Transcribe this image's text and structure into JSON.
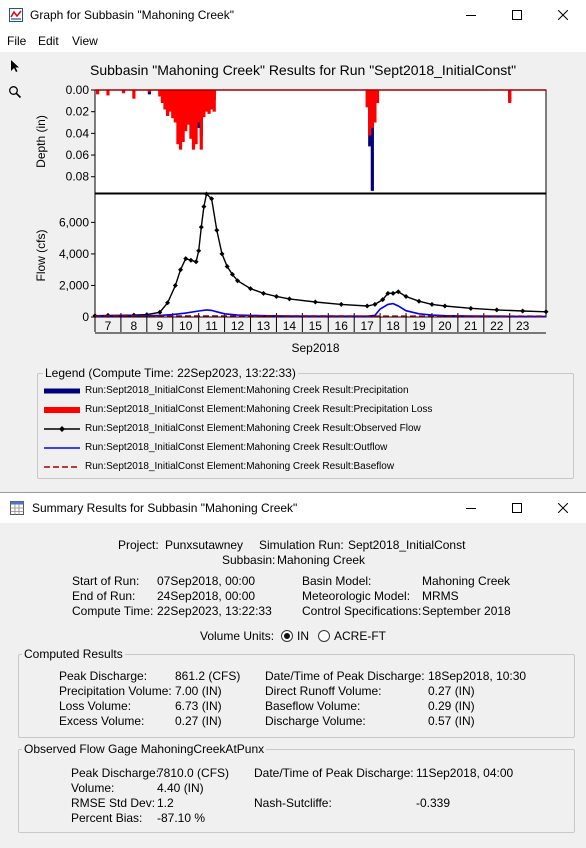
{
  "graph_window": {
    "title": "Graph for Subbasin \"Mahoning Creek\"",
    "menu": [
      "File",
      "Edit",
      "View"
    ],
    "tools": [
      "arrow-icon",
      "zoom-icon"
    ],
    "chart_title": "Subbasin \"Mahoning Creek\" Results for Run \"Sept2018_InitialConst\"",
    "legend_title": "Legend (Compute Time: 22Sep2023, 13:22:33)",
    "legend": [
      {
        "label": "Run:Sept2018_InitialConst Element:Mahoning Creek Result:Precipitation",
        "color": "#00007a",
        "style": "thick"
      },
      {
        "label": "Run:Sept2018_InitialConst Element:Mahoning Creek Result:Precipitation Loss",
        "color": "#ff0000",
        "style": "thick"
      },
      {
        "label": "Run:Sept2018_InitialConst Element:Mahoning Creek Result:Observed Flow",
        "color": "#000000",
        "style": "marker"
      },
      {
        "label": "Run:Sept2018_InitialConst Element:Mahoning Creek Result:Outflow",
        "color": "#0000ff",
        "style": "line"
      },
      {
        "label": "Run:Sept2018_InitialConst Element:Mahoning Creek Result:Baseflow",
        "color": "#a00000",
        "style": "dashed"
      }
    ]
  },
  "chart_data": [
    {
      "type": "bar",
      "ylabel": "Depth (in)",
      "ylim": [
        0.0,
        0.095
      ],
      "inverted": true,
      "yticks": [
        "0.00",
        "0.02",
        "0.04",
        "0.06",
        "0.08"
      ],
      "ytick_values": [
        0.0,
        0.02,
        0.04,
        0.06,
        0.08
      ],
      "xlim": [
        6.5,
        23.9
      ],
      "series": [
        {
          "name": "Precipitation",
          "x": [
            8.6,
            9.2,
            9.3,
            9.8,
            9.9,
            10.3,
            10.5,
            10.6,
            10.8,
            11.1,
            17.1,
            17.2,
            22.5
          ],
          "values": [
            0.004,
            0.012,
            0.008,
            0.012,
            0.02,
            0.026,
            0.035,
            0.043,
            0.01,
            0.009,
            0.052,
            0.093,
            0.01
          ]
        },
        {
          "name": "Precipitation Loss",
          "x": [
            6.6,
            7.0,
            7.6,
            8.0,
            8.6,
            9.0,
            9.1,
            9.2,
            9.3,
            9.4,
            9.5,
            9.6,
            9.7,
            9.8,
            9.9,
            10.0,
            10.1,
            10.2,
            10.3,
            10.4,
            10.5,
            10.6,
            10.7,
            10.8,
            10.9,
            11.0,
            11.1,
            17.0,
            17.1,
            17.2,
            17.3,
            17.4,
            22.5
          ],
          "values": [
            0.004,
            0.005,
            0.003,
            0.008,
            0.002,
            0.006,
            0.012,
            0.018,
            0.024,
            0.02,
            0.026,
            0.03,
            0.05,
            0.055,
            0.048,
            0.038,
            0.032,
            0.045,
            0.055,
            0.05,
            0.03,
            0.055,
            0.025,
            0.02,
            0.022,
            0.018,
            0.02,
            0.016,
            0.042,
            0.035,
            0.03,
            0.012,
            0.012
          ]
        }
      ]
    },
    {
      "type": "line",
      "ylabel": "Flow (cfs)",
      "xlabel": "Sep2018",
      "ylim": [
        0,
        7800
      ],
      "yticks": [
        "0",
        "2,000",
        "4,000",
        "6,000"
      ],
      "ytick_values": [
        0,
        2000,
        4000,
        6000
      ],
      "xlim": [
        6.5,
        23.9
      ],
      "xticks": [
        "7",
        "8",
        "9",
        "10",
        "11",
        "12",
        "13",
        "14",
        "15",
        "16",
        "17",
        "18",
        "19",
        "20",
        "21",
        "22",
        "23"
      ],
      "xtick_values": [
        7,
        8,
        9,
        10,
        11,
        12,
        13,
        14,
        15,
        16,
        17,
        18,
        19,
        20,
        21,
        22,
        23
      ],
      "series": [
        {
          "name": "Observed Flow",
          "x": [
            6.5,
            7,
            8,
            8.5,
            9,
            9.3,
            9.6,
            9.8,
            10,
            10.2,
            10.4,
            10.5,
            10.6,
            10.7,
            10.8,
            11,
            11.2,
            11.4,
            11.6,
            11.8,
            12,
            12.5,
            13,
            13.5,
            14,
            15,
            16,
            17,
            17.3,
            17.6,
            17.8,
            18,
            18.2,
            18.5,
            19,
            19.5,
            20,
            21,
            22,
            23,
            23.9
          ],
          "y": [
            80,
            100,
            120,
            150,
            300,
            900,
            2000,
            3000,
            3700,
            3600,
            3500,
            4200,
            5700,
            7000,
            7800,
            7500,
            5500,
            4000,
            3200,
            2700,
            2300,
            1800,
            1500,
            1300,
            1150,
            950,
            800,
            700,
            800,
            1100,
            1500,
            1500,
            1600,
            1300,
            1000,
            800,
            700,
            550,
            450,
            380,
            330
          ]
        },
        {
          "name": "Outflow",
          "x": [
            6.5,
            7,
            8,
            9,
            9.5,
            10,
            10.5,
            10.8,
            11,
            11.2,
            11.5,
            12,
            13,
            14,
            16,
            17,
            17.3,
            17.5,
            17.8,
            18,
            18.2,
            18.5,
            19,
            19.5,
            20,
            21,
            22,
            23,
            23.9
          ],
          "y": [
            60,
            70,
            80,
            100,
            150,
            250,
            380,
            450,
            420,
            330,
            200,
            120,
            80,
            60,
            50,
            50,
            100,
            500,
            800,
            850,
            700,
            400,
            200,
            120,
            80,
            60,
            50,
            40,
            40
          ]
        },
        {
          "name": "Baseflow",
          "x": [
            6.5,
            23.9
          ],
          "y": [
            70,
            60
          ]
        }
      ]
    }
  ],
  "summary_window": {
    "title": "Summary Results for Subbasin \"Mahoning Creek\"",
    "header": {
      "project_label": "Project:",
      "project": "Punxsutawney",
      "run_label": "Simulation Run:",
      "run": "Sept2018_InitialConst",
      "subbasin_label": "Subbasin:",
      "subbasin": "Mahoning Creek",
      "start_label": "Start of Run:",
      "start": "07Sep2018, 00:00",
      "end_label": "End of Run:",
      "end": "24Sep2018, 00:00",
      "compute_label": "Compute Time:",
      "compute": "22Sep2023, 13:22:33",
      "basin_label": "Basin Model:",
      "basin": "Mahoning Creek",
      "met_label": "Meteorologic Model:",
      "met": "MRMS",
      "control_label": "Control Specifications:",
      "control": "September 2018"
    },
    "volume_units": {
      "label": "Volume Units:",
      "options": [
        "IN",
        "ACRE-FT"
      ],
      "selected": "IN"
    },
    "computed": {
      "title": "Computed Results",
      "peak_label": "Peak Discharge:",
      "peak": "861.2 (CFS)",
      "precip_label": "Precipitation Volume:",
      "precip": "7.00 (IN)",
      "loss_label": "Loss Volume:",
      "loss": "6.73 (IN)",
      "excess_label": "Excess Volume:",
      "excess": "0.27 (IN)",
      "peak_time_label": "Date/Time of Peak Discharge:",
      "peak_time": "18Sep2018, 10:30",
      "runoff_label": "Direct Runoff Volume:",
      "runoff": "0.27 (IN)",
      "baseflow_label": "Baseflow Volume:",
      "baseflow": "0.29 (IN)",
      "discharge_label": "Discharge Volume:",
      "discharge": "0.57 (IN)"
    },
    "observed": {
      "title": "Observed Flow Gage MahoningCreekAtPunx",
      "peak_label": "Peak Discharge:",
      "peak": "7810.0 (CFS)",
      "volume_label": "Volume:",
      "volume": "4.40 (IN)",
      "rmse_label": "RMSE Std Dev:",
      "rmse": "1.2",
      "bias_label": "Percent Bias:",
      "bias": "-87.10 %",
      "peak_time_label": "Date/Time of Peak Discharge:",
      "peak_time": "11Sep2018, 04:00",
      "nash_label": "Nash-Sutcliffe:",
      "nash": "-0.339"
    }
  }
}
